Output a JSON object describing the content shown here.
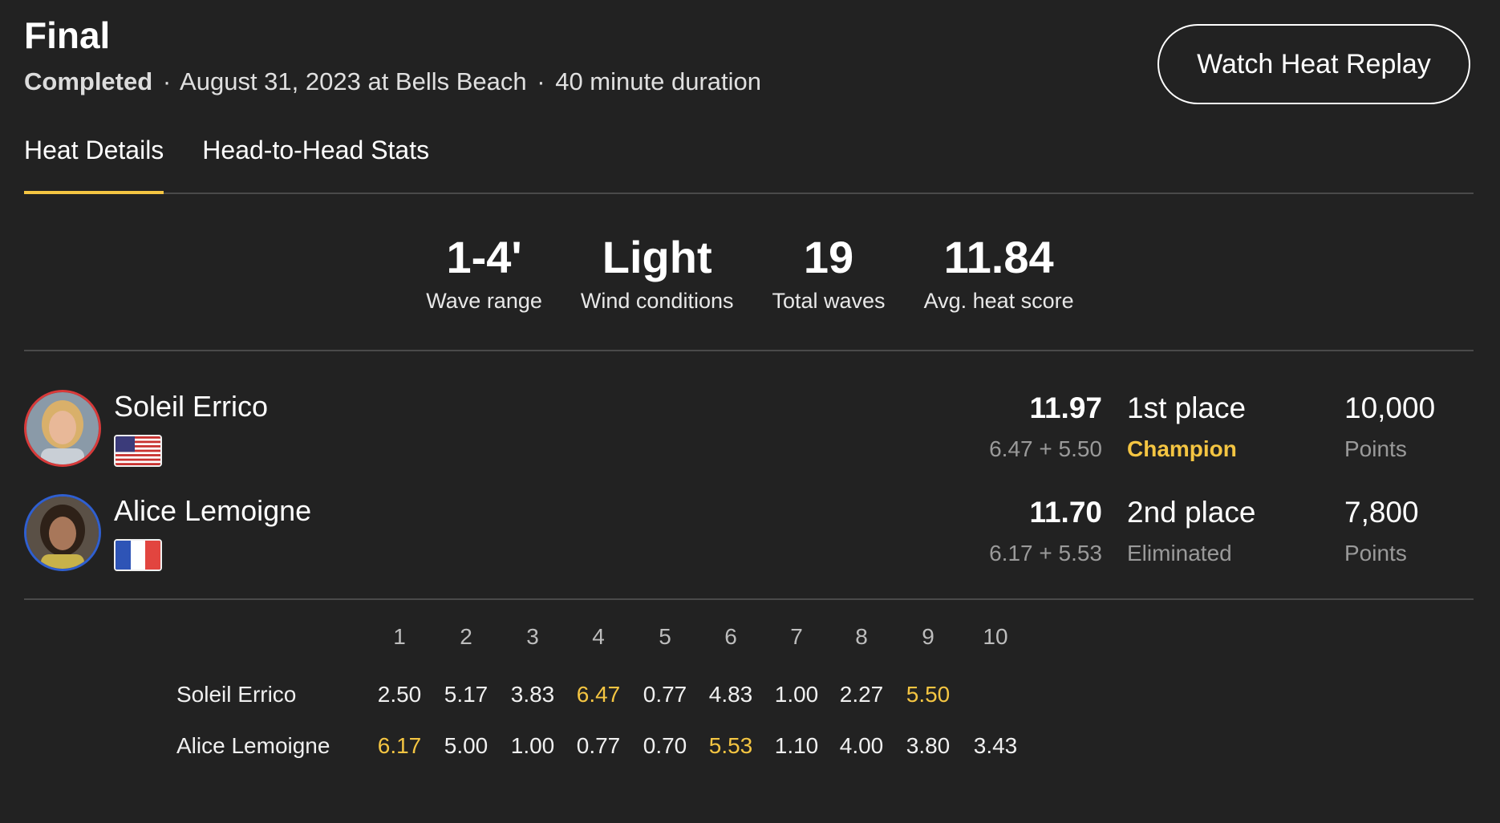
{
  "heat": {
    "title": "Final",
    "status": "Completed",
    "date_location": "August 31, 2023 at Bells Beach",
    "duration": "40 minute duration",
    "separator": "·"
  },
  "actions": {
    "replay_label": "Watch Heat Replay"
  },
  "tabs": [
    {
      "label": "Heat Details",
      "active": true
    },
    {
      "label": "Head-to-Head Stats",
      "active": false
    }
  ],
  "stats": [
    {
      "value": "1-4'",
      "label": "Wave range"
    },
    {
      "value": "Light",
      "label": "Wind conditions"
    },
    {
      "value": "19",
      "label": "Total waves"
    },
    {
      "value": "11.84",
      "label": "Avg. heat score"
    }
  ],
  "surfers": [
    {
      "name": "Soleil Errico",
      "flag": "us-flag-icon",
      "total": "11.97",
      "breakdown": "6.47 + 5.50",
      "place": "1st place",
      "result": "Champion",
      "points": "10,000",
      "points_label": "Points",
      "ring_color": "#d83a3a"
    },
    {
      "name": "Alice Lemoigne",
      "flag": "fr-flag-icon",
      "total": "11.70",
      "breakdown": "6.17 + 5.53",
      "place": "2nd place",
      "result": "Eliminated",
      "points": "7,800",
      "points_label": "Points",
      "ring_color": "#2f5fd0"
    }
  ],
  "wave_table": {
    "columns": [
      "1",
      "2",
      "3",
      "4",
      "5",
      "6",
      "7",
      "8",
      "9",
      "10"
    ],
    "rows": [
      {
        "name": "Soleil Errico",
        "scores": [
          "2.50",
          "5.17",
          "3.83",
          "6.47",
          "0.77",
          "4.83",
          "1.00",
          "2.27",
          "5.50",
          ""
        ],
        "best_indices": [
          3,
          8
        ]
      },
      {
        "name": "Alice Lemoigne",
        "scores": [
          "6.17",
          "5.00",
          "1.00",
          "0.77",
          "0.70",
          "5.53",
          "1.10",
          "4.00",
          "3.80",
          "3.43"
        ],
        "best_indices": [
          0,
          5
        ]
      }
    ]
  },
  "colors": {
    "accent": "#f4c542",
    "background": "#222222",
    "muted": "#9a9a9a"
  }
}
